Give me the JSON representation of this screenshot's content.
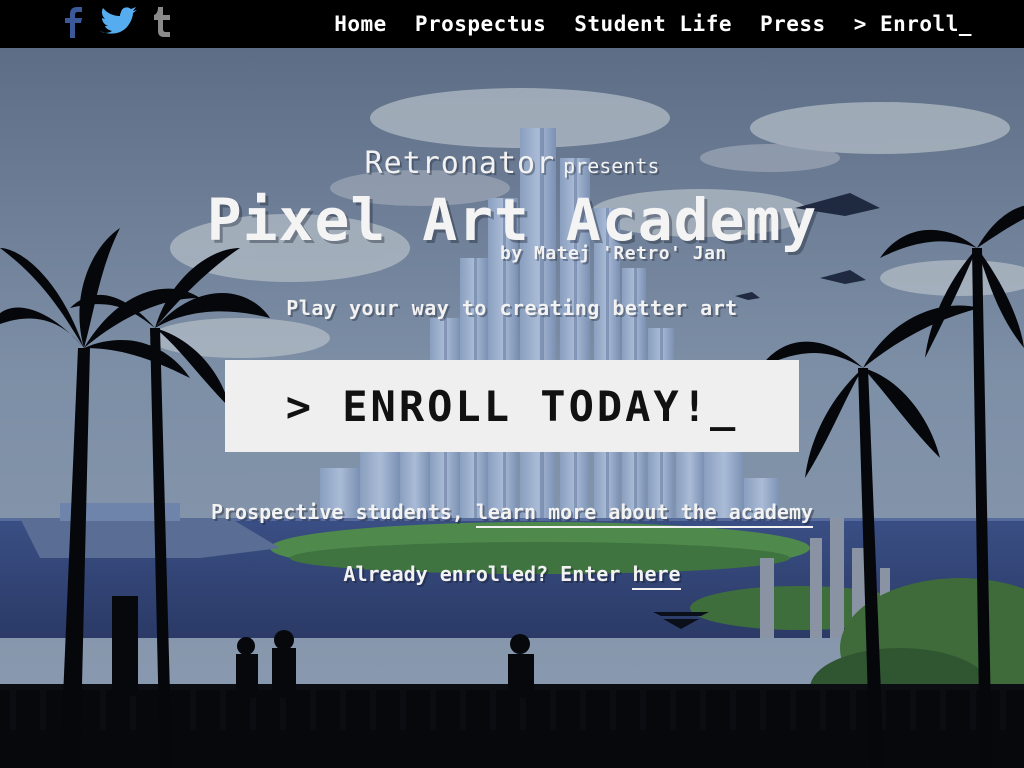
{
  "nav": {
    "social": [
      {
        "name": "facebook",
        "glyph": "f",
        "icon": "facebook-icon",
        "color": "#3b5998"
      },
      {
        "name": "twitter",
        "icon": "twitter-icon",
        "color": "#55acee"
      },
      {
        "name": "tumblr",
        "glyph": "t",
        "icon": "tumblr-icon",
        "color": "#8a8a8a"
      }
    ],
    "links": [
      {
        "label": "Home"
      },
      {
        "label": "Prospectus"
      },
      {
        "label": "Student Life"
      },
      {
        "label": "Press"
      },
      {
        "label": "> Enroll_"
      }
    ]
  },
  "hero": {
    "brand": "Retronator",
    "presents": "presents",
    "title": "Pixel Art Academy",
    "byline": "by Matej 'Retro' Jan",
    "tagline": "Play your way to creating better art",
    "cta_label": "> ENROLL TODAY!_",
    "prospective_prefix": "Prospective students, ",
    "prospective_link": "learn more about the academy",
    "enrolled_prefix": "Already enrolled? Enter ",
    "enrolled_link": "here"
  },
  "colors": {
    "topbar": "#000000",
    "cta_background": "#efefef",
    "cta_text": "#111111",
    "text": "#f2f2f2"
  }
}
